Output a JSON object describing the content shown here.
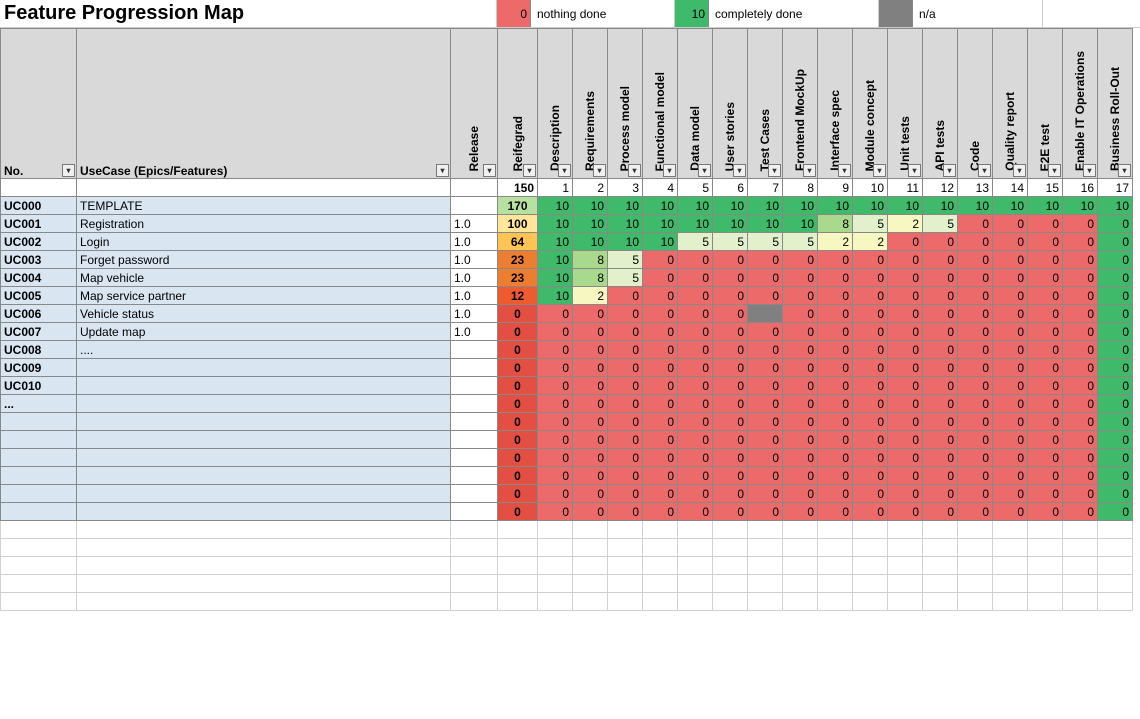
{
  "title": "Feature Progression Map",
  "legend": {
    "nothing_val": "0",
    "nothing_label": "nothing done",
    "done_val": "10",
    "done_label": "completely done",
    "na_label": "n/a"
  },
  "headers": {
    "no": "No.",
    "usecase": "UseCase (Epics/Features)",
    "release": "Release",
    "reifegrad": "Reifegrad",
    "cols": [
      "Description",
      "Requirements",
      "Process model",
      "Functional model",
      "Data model",
      "User stories",
      "Test Cases",
      "Frontend MockUp",
      "Interface spec",
      "Module concept",
      "Unit tests",
      "API tests",
      "Code",
      "Quality report",
      "E2E test",
      "Enable IT Operations",
      "Business Roll-Out"
    ],
    "col_index": [
      "1",
      "2",
      "3",
      "4",
      "5",
      "6",
      "7",
      "8",
      "9",
      "10",
      "11",
      "12",
      "13",
      "14",
      "15",
      "16",
      "17"
    ],
    "total_reif": "150"
  },
  "chart_data": {
    "type": "heatmap",
    "title": "Feature Progression Map",
    "x_categories": [
      "Description",
      "Requirements",
      "Process model",
      "Functional model",
      "Data model",
      "User stories",
      "Test Cases",
      "Frontend MockUp",
      "Interface spec",
      "Module concept",
      "Unit tests",
      "API tests",
      "Code",
      "Quality report",
      "E2E test",
      "Enable IT Operations",
      "Business Roll-Out"
    ],
    "y_categories": [
      "UC000 TEMPLATE",
      "UC001 Registration",
      "UC002 Login",
      "UC003 Forget password",
      "UC004 Map vehicle",
      "UC005 Map service partner",
      "UC006 Vehicle status",
      "UC007 Update map",
      "UC008 ....",
      "UC009",
      "UC010",
      "..."
    ],
    "value_scale": {
      "min": 0,
      "max": 10,
      "na": "grey"
    },
    "series": [
      {
        "name": "UC000",
        "reifegrad": 170,
        "values": [
          10,
          10,
          10,
          10,
          10,
          10,
          10,
          10,
          10,
          10,
          10,
          10,
          10,
          10,
          10,
          10,
          10
        ]
      },
      {
        "name": "UC001",
        "reifegrad": 100,
        "values": [
          10,
          10,
          10,
          10,
          10,
          10,
          10,
          10,
          8,
          5,
          2,
          5,
          0,
          0,
          0,
          0,
          0
        ]
      },
      {
        "name": "UC002",
        "reifegrad": 64,
        "values": [
          10,
          10,
          10,
          10,
          5,
          5,
          5,
          5,
          2,
          2,
          0,
          0,
          0,
          0,
          0,
          0,
          0
        ]
      },
      {
        "name": "UC003",
        "reifegrad": 23,
        "values": [
          10,
          8,
          5,
          0,
          0,
          0,
          0,
          0,
          0,
          0,
          0,
          0,
          0,
          0,
          0,
          0,
          0
        ]
      },
      {
        "name": "UC004",
        "reifegrad": 23,
        "values": [
          10,
          8,
          5,
          0,
          0,
          0,
          0,
          0,
          0,
          0,
          0,
          0,
          0,
          0,
          0,
          0,
          0
        ]
      },
      {
        "name": "UC005",
        "reifegrad": 12,
        "values": [
          10,
          2,
          0,
          0,
          0,
          0,
          0,
          0,
          0,
          0,
          0,
          0,
          0,
          0,
          0,
          0,
          0
        ]
      },
      {
        "name": "UC006",
        "reifegrad": 0,
        "values": [
          0,
          0,
          0,
          0,
          0,
          0,
          "na",
          0,
          0,
          0,
          0,
          0,
          0,
          0,
          0,
          0,
          0
        ]
      },
      {
        "name": "UC007",
        "reifegrad": 0,
        "values": [
          0,
          0,
          0,
          0,
          0,
          0,
          0,
          0,
          0,
          0,
          0,
          0,
          0,
          0,
          0,
          0,
          0
        ]
      },
      {
        "name": "UC008",
        "reifegrad": 0,
        "values": [
          0,
          0,
          0,
          0,
          0,
          0,
          0,
          0,
          0,
          0,
          0,
          0,
          0,
          0,
          0,
          0,
          0
        ]
      },
      {
        "name": "UC009",
        "reifegrad": 0,
        "values": [
          0,
          0,
          0,
          0,
          0,
          0,
          0,
          0,
          0,
          0,
          0,
          0,
          0,
          0,
          0,
          0,
          0
        ]
      },
      {
        "name": "UC010",
        "reifegrad": 0,
        "values": [
          0,
          0,
          0,
          0,
          0,
          0,
          0,
          0,
          0,
          0,
          0,
          0,
          0,
          0,
          0,
          0,
          0
        ]
      },
      {
        "name": "...",
        "reifegrad": 0,
        "values": [
          0,
          0,
          0,
          0,
          0,
          0,
          0,
          0,
          0,
          0,
          0,
          0,
          0,
          0,
          0,
          0,
          0
        ]
      }
    ],
    "last_green_column_index": 16
  },
  "rows": [
    {
      "no": "UC000",
      "uc": "TEMPLATE",
      "rel": "",
      "reif": 170,
      "reifcls": "reif-170",
      "v": [
        10,
        10,
        10,
        10,
        10,
        10,
        10,
        10,
        10,
        10,
        10,
        10,
        10,
        10,
        10,
        10,
        10
      ]
    },
    {
      "no": "UC001",
      "uc": "Registration",
      "rel": "1.0",
      "reif": 100,
      "reifcls": "reif-100",
      "v": [
        10,
        10,
        10,
        10,
        10,
        10,
        10,
        10,
        8,
        5,
        2,
        5,
        0,
        0,
        0,
        0,
        0
      ]
    },
    {
      "no": "UC002",
      "uc": "Login",
      "rel": "1.0",
      "reif": 64,
      "reifcls": "reif-64",
      "v": [
        10,
        10,
        10,
        10,
        5,
        5,
        5,
        5,
        2,
        2,
        0,
        0,
        0,
        0,
        0,
        0,
        0
      ]
    },
    {
      "no": "UC003",
      "uc": "Forget password",
      "rel": "1.0",
      "reif": 23,
      "reifcls": "reif-23",
      "v": [
        10,
        8,
        5,
        0,
        0,
        0,
        0,
        0,
        0,
        0,
        0,
        0,
        0,
        0,
        0,
        0,
        0
      ]
    },
    {
      "no": "UC004",
      "uc": "Map vehicle",
      "rel": "1.0",
      "reif": 23,
      "reifcls": "reif-23",
      "v": [
        10,
        8,
        5,
        0,
        0,
        0,
        0,
        0,
        0,
        0,
        0,
        0,
        0,
        0,
        0,
        0,
        0
      ]
    },
    {
      "no": "UC005",
      "uc": "Map service partner",
      "rel": "1.0",
      "reif": 12,
      "reifcls": "reif-12",
      "v": [
        10,
        2,
        0,
        0,
        0,
        0,
        0,
        0,
        0,
        0,
        0,
        0,
        0,
        0,
        0,
        0,
        0
      ]
    },
    {
      "no": "UC006",
      "uc": "Vehicle status",
      "rel": "1.0",
      "reif": 0,
      "reifcls": "reif-0",
      "v": [
        0,
        0,
        0,
        0,
        0,
        0,
        "na",
        0,
        0,
        0,
        0,
        0,
        0,
        0,
        0,
        0,
        0
      ]
    },
    {
      "no": "UC007",
      "uc": "Update map",
      "rel": "1.0",
      "reif": 0,
      "reifcls": "reif-0",
      "v": [
        0,
        0,
        0,
        0,
        0,
        0,
        0,
        0,
        0,
        0,
        0,
        0,
        0,
        0,
        0,
        0,
        0
      ]
    },
    {
      "no": "UC008",
      "uc": "....",
      "rel": "",
      "reif": 0,
      "reifcls": "reif-0",
      "v": [
        0,
        0,
        0,
        0,
        0,
        0,
        0,
        0,
        0,
        0,
        0,
        0,
        0,
        0,
        0,
        0,
        0
      ]
    },
    {
      "no": "UC009",
      "uc": "",
      "rel": "",
      "reif": 0,
      "reifcls": "reif-0",
      "v": [
        0,
        0,
        0,
        0,
        0,
        0,
        0,
        0,
        0,
        0,
        0,
        0,
        0,
        0,
        0,
        0,
        0
      ]
    },
    {
      "no": "UC010",
      "uc": "",
      "rel": "",
      "reif": 0,
      "reifcls": "reif-0",
      "v": [
        0,
        0,
        0,
        0,
        0,
        0,
        0,
        0,
        0,
        0,
        0,
        0,
        0,
        0,
        0,
        0,
        0
      ]
    },
    {
      "no": "...",
      "uc": "",
      "rel": "",
      "reif": 0,
      "reifcls": "reif-0",
      "v": [
        0,
        0,
        0,
        0,
        0,
        0,
        0,
        0,
        0,
        0,
        0,
        0,
        0,
        0,
        0,
        0,
        0
      ]
    },
    {
      "no": "",
      "uc": "",
      "rel": "",
      "reif": 0,
      "reifcls": "reif-0",
      "v": [
        0,
        0,
        0,
        0,
        0,
        0,
        0,
        0,
        0,
        0,
        0,
        0,
        0,
        0,
        0,
        0,
        0
      ]
    },
    {
      "no": "",
      "uc": "",
      "rel": "",
      "reif": 0,
      "reifcls": "reif-0",
      "v": [
        0,
        0,
        0,
        0,
        0,
        0,
        0,
        0,
        0,
        0,
        0,
        0,
        0,
        0,
        0,
        0,
        0
      ]
    },
    {
      "no": "",
      "uc": "",
      "rel": "",
      "reif": 0,
      "reifcls": "reif-0",
      "v": [
        0,
        0,
        0,
        0,
        0,
        0,
        0,
        0,
        0,
        0,
        0,
        0,
        0,
        0,
        0,
        0,
        0
      ]
    },
    {
      "no": "",
      "uc": "",
      "rel": "",
      "reif": 0,
      "reifcls": "reif-0",
      "v": [
        0,
        0,
        0,
        0,
        0,
        0,
        0,
        0,
        0,
        0,
        0,
        0,
        0,
        0,
        0,
        0,
        0
      ]
    },
    {
      "no": "",
      "uc": "",
      "rel": "",
      "reif": 0,
      "reifcls": "reif-0",
      "v": [
        0,
        0,
        0,
        0,
        0,
        0,
        0,
        0,
        0,
        0,
        0,
        0,
        0,
        0,
        0,
        0,
        0
      ]
    },
    {
      "no": "",
      "uc": "",
      "rel": "",
      "reif": 0,
      "reifcls": "reif-0",
      "v": [
        0,
        0,
        0,
        0,
        0,
        0,
        0,
        0,
        0,
        0,
        0,
        0,
        0,
        0,
        0,
        0,
        0
      ]
    }
  ],
  "trailing_empty_rows": 5
}
